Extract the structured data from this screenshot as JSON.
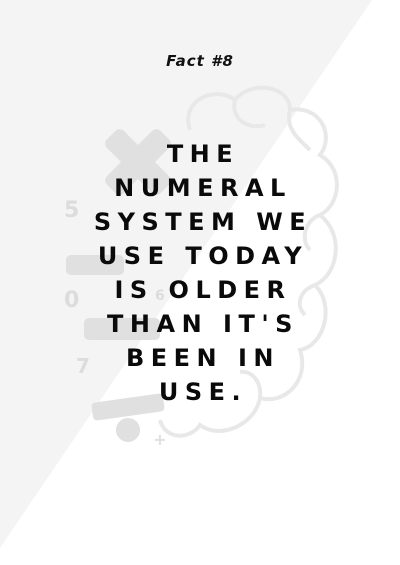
{
  "fact_label": "Fact #8",
  "headline_lines": [
    "THE",
    "NUMERAL",
    "SYSTEM WE",
    "USE TODAY",
    "IS OLDER",
    "THAN IT'S",
    "BEEN IN",
    "USE."
  ],
  "decor_numbers": [
    "5",
    "0",
    "7",
    "6"
  ],
  "colors": {
    "background_light": "#f4f4f4",
    "background": "#ffffff",
    "text": "#0a0a0a",
    "decor": "#e2e2e2",
    "brain_outline": "#ebebeb"
  }
}
